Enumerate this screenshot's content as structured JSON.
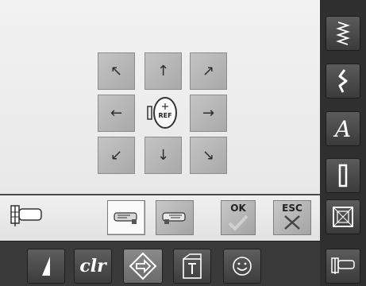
{
  "screen": "embroidery-move-motif",
  "grid": {
    "up_left": "↖",
    "up": "↑",
    "up_right": "↗",
    "left": "←",
    "right": "→",
    "down_left": "↙",
    "down": "↓",
    "down_right": "↘",
    "center_label": "REF"
  },
  "toolbar": {
    "ok_label": "OK",
    "esc_label": "ESC"
  },
  "bottom_bar": {
    "clr_label": "clr"
  },
  "right_bar": {
    "alphabet_label": "A"
  },
  "colors": {
    "ok_check": "#c9c9c9",
    "panel_dark": "#2f2f2f"
  }
}
